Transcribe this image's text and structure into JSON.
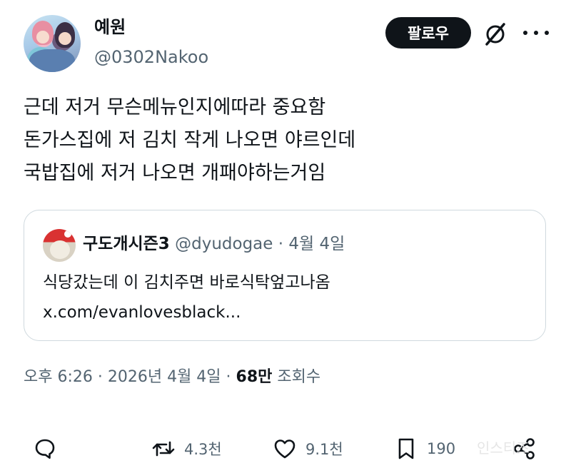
{
  "author": {
    "display_name": "예원",
    "handle": "@0302Nakoo"
  },
  "header": {
    "follow_label": "팔로우",
    "grok_icon": "grok-icon",
    "more_icon": "more-icon"
  },
  "tweet": {
    "lines": [
      "근데 저거 무슨메뉴인지에따라 중요함",
      "돈가스집에 저 김치 작게 나오면 야르인데",
      "국밥집에 저거 나오면 개패야하는거임"
    ]
  },
  "quote": {
    "name": "구도개시즌3",
    "handle": "@dyudogae",
    "separator": "·",
    "date": "4월 4일",
    "text": "식당갔는데 이 김치주면 바로식탁엎고나옴",
    "link": "x.com/evanlovesblack..."
  },
  "meta": {
    "timestamp": "오후 6:26 · 2026년 4월 4일 · ",
    "views_count": "68만",
    "views_label": " 조회수"
  },
  "actions": {
    "reply_icon": "reply-icon",
    "retweet_count": "4.3천",
    "like_count": "9.1천",
    "bookmark_count": "190",
    "share_icon": "share-icon"
  },
  "watermark": "인스티즈"
}
